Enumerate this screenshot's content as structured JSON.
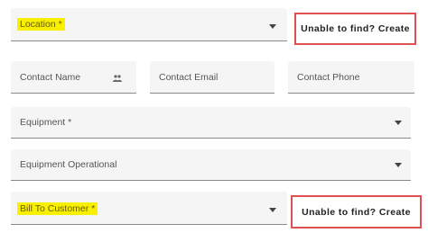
{
  "form": {
    "location": {
      "label": "Location *"
    },
    "create_button_1": "Unable to find? Create",
    "contact_name": {
      "label": "Contact Name",
      "icon": "contacts-icon"
    },
    "contact_email": {
      "label": "Contact Email"
    },
    "contact_phone": {
      "label": "Contact Phone"
    },
    "equipment": {
      "label": "Equipment *"
    },
    "equipment_operational": {
      "label": "Equipment Operational"
    },
    "bill_to_customer": {
      "label": "Bill To Customer *"
    },
    "create_button_2": "Unable to find? Create"
  },
  "colors": {
    "highlight": "#f8f000",
    "button_outline": "#e05050",
    "field_bg": "#f5f5f5"
  }
}
